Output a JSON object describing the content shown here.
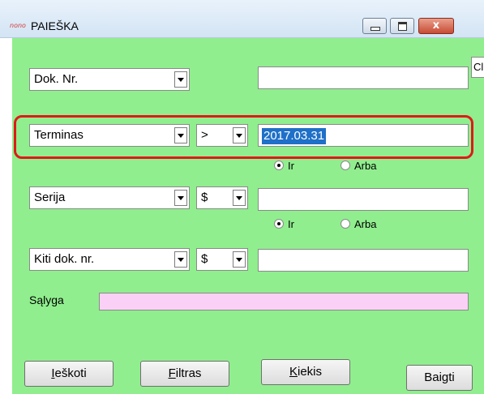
{
  "window": {
    "icon_text": "nono",
    "title": "PAIEŠKA",
    "close_glyph": "x"
  },
  "clipped_text": "Cl",
  "rows": {
    "dok_nr": {
      "field": "Dok. Nr.",
      "value": ""
    },
    "terminas": {
      "field": "Terminas",
      "operator": ">",
      "value": "2017.03.31"
    },
    "serija": {
      "field": "Serija",
      "operator": "$",
      "value": ""
    },
    "kiti": {
      "field": "Kiti dok. nr.",
      "operator": "$",
      "value": ""
    }
  },
  "radio_groups": [
    {
      "options": [
        "Ir",
        "Arba"
      ],
      "selected": "Ir"
    },
    {
      "options": [
        "Ir",
        "Arba"
      ],
      "selected": "Ir"
    }
  ],
  "condition": {
    "label": "Sąlyga",
    "value": ""
  },
  "buttons": {
    "search": {
      "accel": "I",
      "rest": "eškoti"
    },
    "filter": {
      "accel": "F",
      "rest": "iltras"
    },
    "count": {
      "accel": "K",
      "rest": "iekis"
    },
    "finish": {
      "label": "Baigti"
    }
  },
  "colors": {
    "panel": "#90ee8e",
    "condition_field": "#fad0f6",
    "highlight": "#e01919",
    "selection": "#1f70c8"
  }
}
